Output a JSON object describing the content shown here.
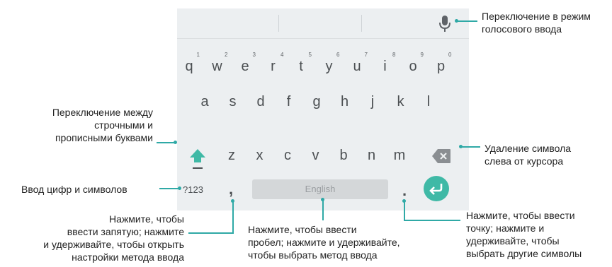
{
  "keyboard": {
    "row1": [
      {
        "letter": "q",
        "digit": "1"
      },
      {
        "letter": "w",
        "digit": "2"
      },
      {
        "letter": "e",
        "digit": "3"
      },
      {
        "letter": "r",
        "digit": "4"
      },
      {
        "letter": "t",
        "digit": "5"
      },
      {
        "letter": "y",
        "digit": "6"
      },
      {
        "letter": "u",
        "digit": "7"
      },
      {
        "letter": "i",
        "digit": "8"
      },
      {
        "letter": "o",
        "digit": "9"
      },
      {
        "letter": "p",
        "digit": "0"
      }
    ],
    "row2": [
      "a",
      "s",
      "d",
      "f",
      "g",
      "h",
      "j",
      "k",
      "l"
    ],
    "row3": [
      "z",
      "x",
      "c",
      "v",
      "b",
      "n",
      "m"
    ],
    "symbols_label": "?123",
    "comma_label": ",",
    "space_label": "English",
    "period_label": ".",
    "icons": {
      "voice": "microphone-icon",
      "shift": "shift-arrow-icon",
      "backspace": "backspace-icon",
      "enter": "enter-arrow-icon"
    },
    "colors": {
      "keyboard_bg": "#eceff1",
      "key_text": "#4b4f52",
      "accent": "#3fb9a6"
    }
  },
  "callouts": {
    "voice": "Переключение в режим\nголосового ввода",
    "case": "Переключение между\nстрочными и\nпрописными буквами",
    "delete": "Удаление символа\nслева от курсора",
    "symbols": "Ввод цифр и символов",
    "comma": "Нажмите, чтобы\nввести запятую; нажмите\nи удерживайте, чтобы открыть\nнастройки метода ввода",
    "space": "Нажмите, чтобы ввести\nпробел; нажмите и удерживайте,\nчтобы выбрать метод ввода",
    "period": "Нажмите, чтобы ввести\nточку; нажмите и\nудерживайте, чтобы\nвыбрать другие символы"
  }
}
